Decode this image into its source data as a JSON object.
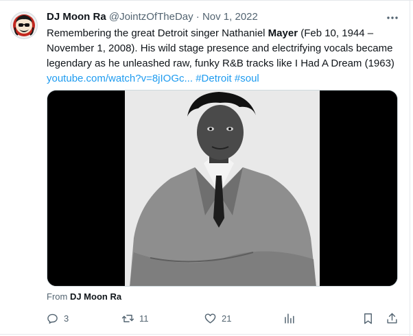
{
  "tweet": {
    "display_name": "DJ Moon Ra",
    "handle": "@JointzOfTheDay",
    "separator": " · ",
    "date": "Nov 1, 2022",
    "text_before": "Remembering the great Detroit singer Nathaniel ",
    "text_bold": "Mayer",
    "text_after": " (Feb 10, 1944 – November 1, 2008). His wild stage presence and electrifying vocals became legendary as he unleashed raw, funky R&B tracks like I Had A Dream (1963) ",
    "link": "youtube.com/watch?v=8jIOGc...",
    "hashtag_1": "#Detroit",
    "hashtag_2": "#soul",
    "from_prefix": "From ",
    "from_name": "DJ Moon Ra"
  },
  "actions": {
    "replies": "3",
    "retweets": "11",
    "likes": "21"
  },
  "icons": [
    "more-icon",
    "reply-icon",
    "retweet-icon",
    "like-icon",
    "views-icon",
    "bookmark-icon",
    "share-icon"
  ]
}
